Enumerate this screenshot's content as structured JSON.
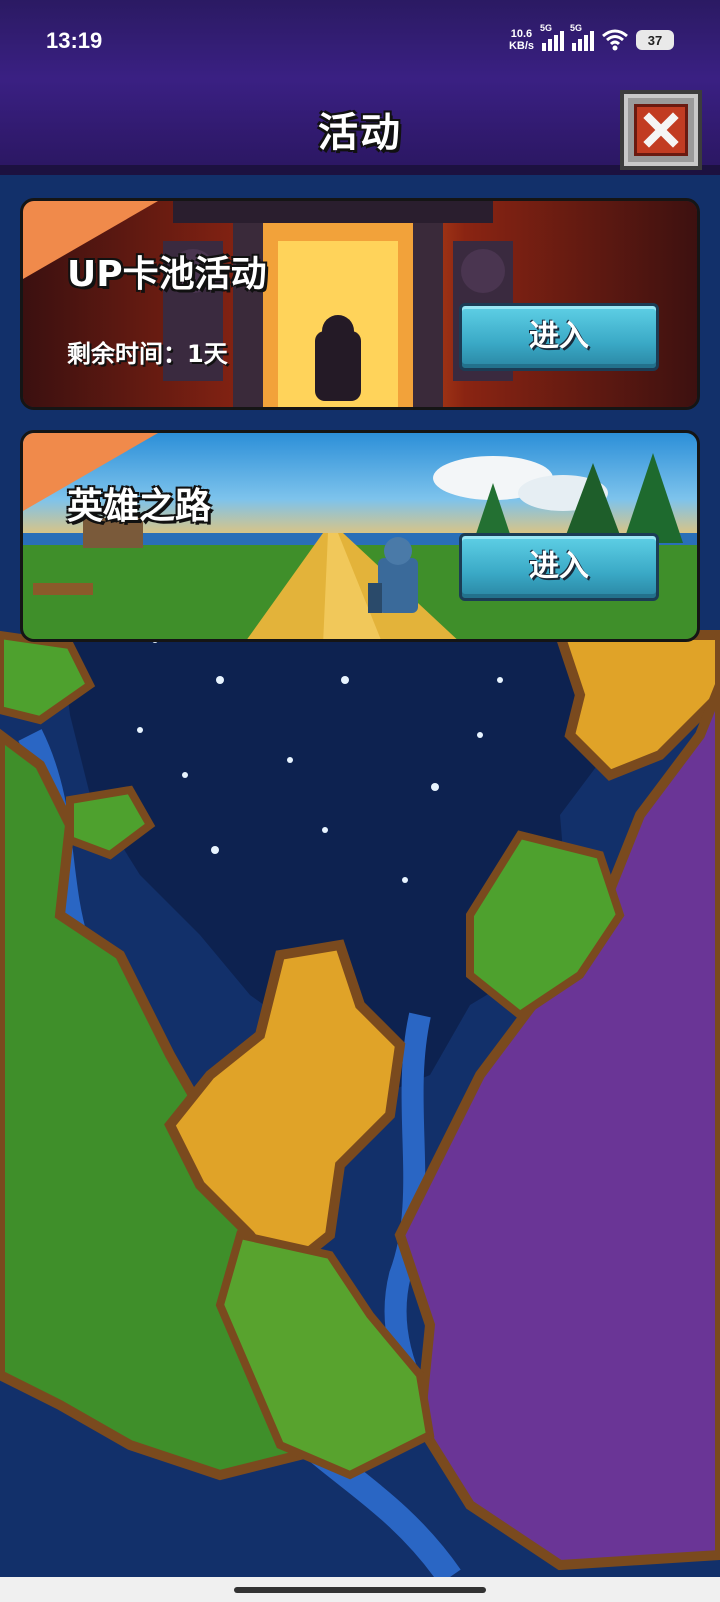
{
  "status_bar": {
    "time": "13:19",
    "net_speed_value": "10.6",
    "net_speed_unit": "KB/s",
    "signal1_label": "5G",
    "signal2_label": "5G",
    "battery": "37"
  },
  "header": {
    "title": "活动",
    "close_icon": "close-icon"
  },
  "events": [
    {
      "title": "UP卡池活动",
      "subtitle": "剩余时间：1天",
      "button_label": "进入"
    },
    {
      "title": "英雄之路",
      "button_label": "进入"
    }
  ],
  "colors": {
    "header_purple": "#3a2083",
    "corner_orange": "#f08a4b",
    "button_cyan": "#3aa9c6",
    "close_red": "#c23c22"
  }
}
